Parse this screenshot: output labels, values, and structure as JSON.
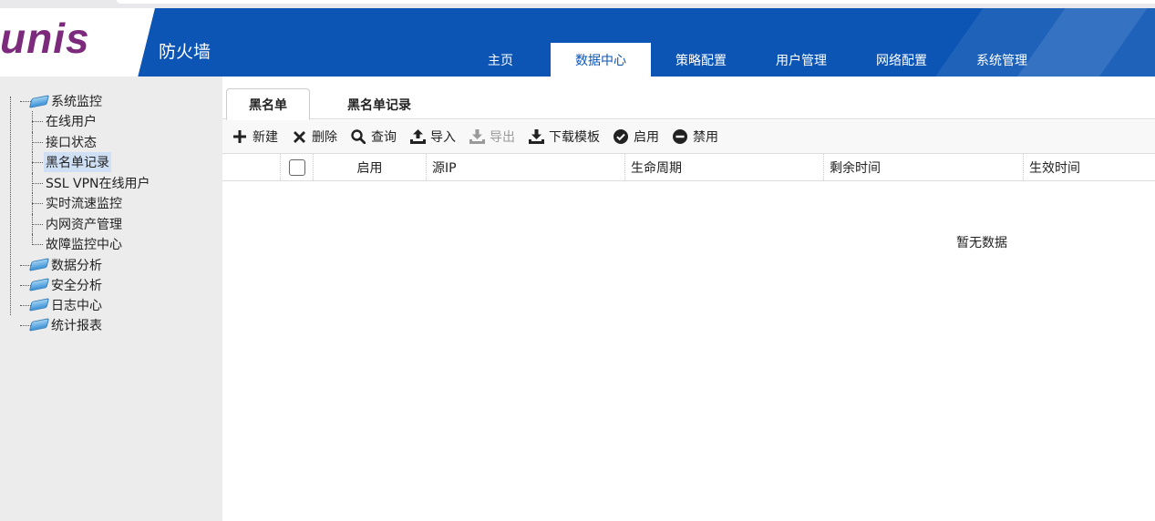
{
  "header": {
    "logo": "unis",
    "title": "防火墙",
    "brand_color": "#0c55b5",
    "logo_color": "#7b2a7c"
  },
  "nav": {
    "items": [
      {
        "label": "主页",
        "active": false
      },
      {
        "label": "数据中心",
        "active": true
      },
      {
        "label": "策略配置",
        "active": false
      },
      {
        "label": "用户管理",
        "active": false
      },
      {
        "label": "网络配置",
        "active": false
      },
      {
        "label": "系统管理",
        "active": false
      }
    ]
  },
  "sidebar": {
    "groups": [
      {
        "label": "系统监控",
        "children": [
          "在线用户",
          "接口状态",
          "黑名单记录",
          "SSL VPN在线用户",
          "实时流速监控",
          "内网资产管理",
          "故障监控中心"
        ],
        "selected": "黑名单记录"
      },
      {
        "label": "数据分析"
      },
      {
        "label": "安全分析"
      },
      {
        "label": "日志中心"
      },
      {
        "label": "统计报表"
      }
    ]
  },
  "subtabs": [
    {
      "label": "黑名单",
      "active": true
    },
    {
      "label": "黑名单记录",
      "active": false
    }
  ],
  "toolbar": {
    "new": "新建",
    "delete": "删除",
    "query": "查询",
    "import": "导入",
    "export": "导出",
    "download_template": "下载模板",
    "enable": "启用",
    "disable": "禁用"
  },
  "grid": {
    "columns": [
      "启用",
      "源IP",
      "生命周期",
      "剩余时间",
      "生效时间"
    ],
    "empty_text": "暂无数据"
  }
}
